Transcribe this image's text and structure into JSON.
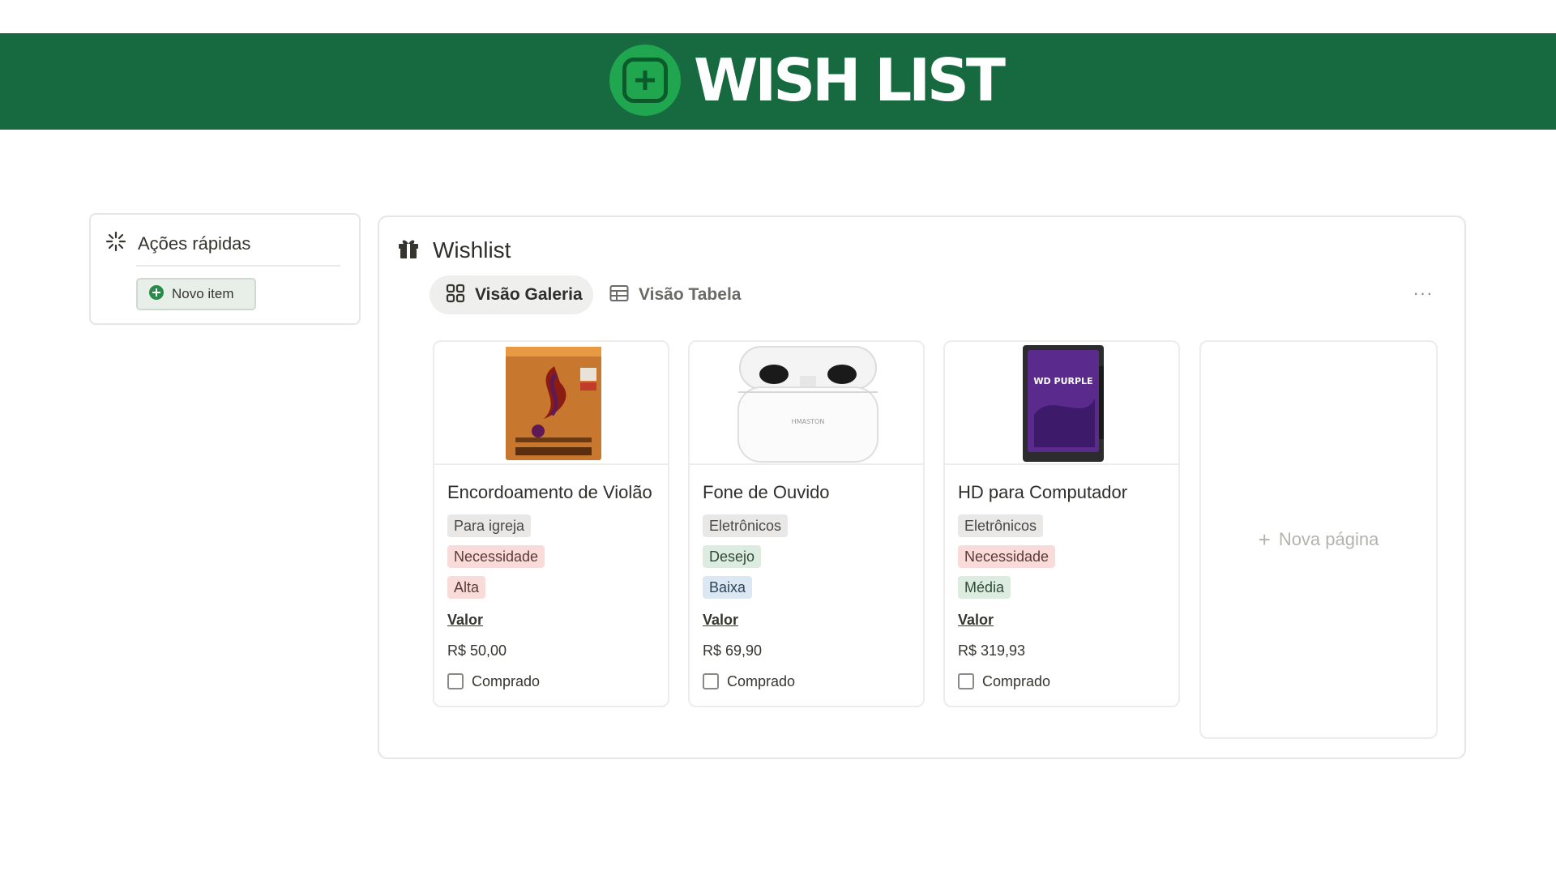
{
  "banner": {
    "title": "WISH LIST"
  },
  "quick_actions": {
    "title": "Ações rápidas",
    "new_item_label": "Novo item"
  },
  "wishlist": {
    "title": "Wishlist",
    "tabs": [
      {
        "label": "Visão Galeria",
        "active": true
      },
      {
        "label": "Visão Tabela",
        "active": false
      }
    ],
    "more_label": "···",
    "new_page_label": "Nova página",
    "cards": [
      {
        "title": "Encordoamento de Violão",
        "tags": [
          {
            "text": "Para igreja",
            "color": "gray"
          },
          {
            "text": "Necessidade",
            "color": "red"
          },
          {
            "text": "Alta",
            "color": "red"
          }
        ],
        "value_label": "Valor",
        "value": "R$ 50,00",
        "checkbox_label": "Comprado",
        "checked": false,
        "image": "guitar-strings-package"
      },
      {
        "title": "Fone de Ouvido",
        "tags": [
          {
            "text": "Eletrônicos",
            "color": "gray"
          },
          {
            "text": "Desejo",
            "color": "green"
          },
          {
            "text": "Baixa",
            "color": "blue"
          }
        ],
        "value_label": "Valor",
        "value": "R$ 69,90",
        "checkbox_label": "Comprado",
        "checked": false,
        "image": "earbuds-case",
        "image_text": "HMASTON"
      },
      {
        "title": "HD para Computador",
        "tags": [
          {
            "text": "Eletrônicos",
            "color": "gray"
          },
          {
            "text": "Necessidade",
            "color": "red"
          },
          {
            "text": "Média",
            "color": "green"
          }
        ],
        "value_label": "Valor",
        "value": "R$ 319,93",
        "checkbox_label": "Comprado",
        "checked": false,
        "image": "hard-drive",
        "image_text": "WD PURPLE"
      }
    ]
  },
  "colors": {
    "banner": "#17693f",
    "logo": "#1fa64f",
    "tag_gray": "#e9e8e6",
    "tag_red": "#f9dcd9",
    "tag_green": "#dcece0",
    "tag_blue": "#dbe8f4"
  }
}
